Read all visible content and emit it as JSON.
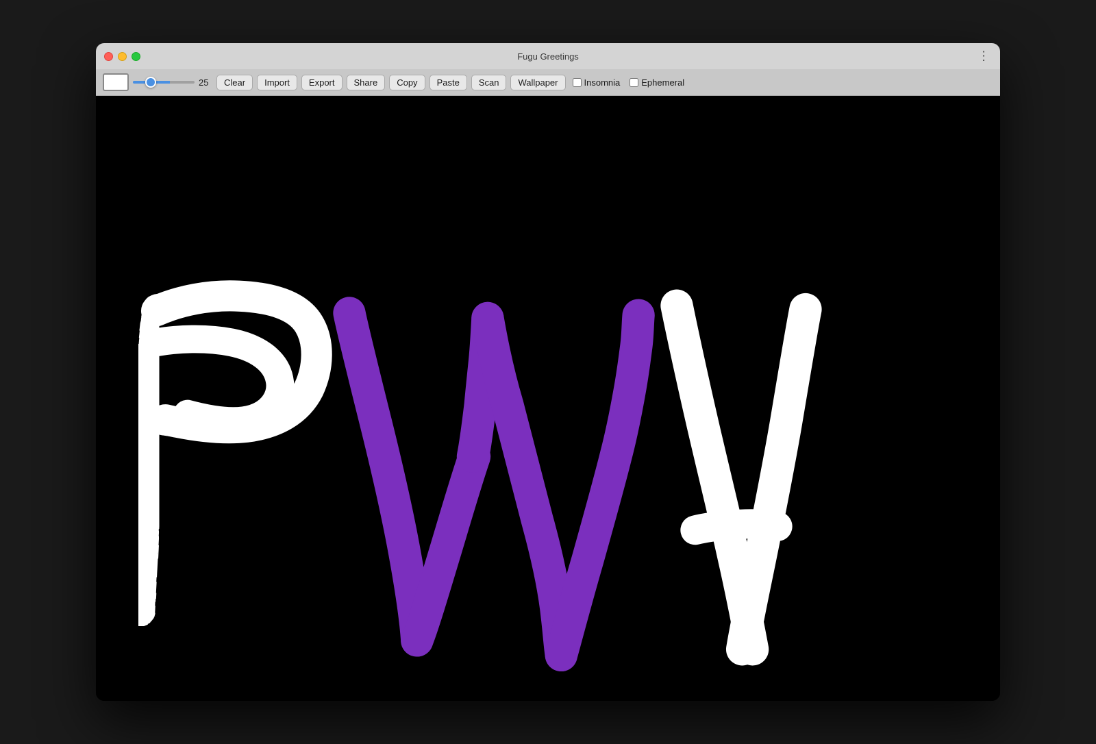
{
  "window": {
    "title": "Fugu Greetings",
    "traffic_lights": {
      "red": "close",
      "yellow": "minimize",
      "green": "fullscreen"
    },
    "menu_dots": "⋮"
  },
  "toolbar": {
    "color_swatch_color": "#ffffff",
    "brush_size": 25,
    "brush_min": 1,
    "brush_max": 100,
    "buttons": [
      {
        "id": "clear",
        "label": "Clear"
      },
      {
        "id": "import",
        "label": "Import"
      },
      {
        "id": "export",
        "label": "Export"
      },
      {
        "id": "share",
        "label": "Share"
      },
      {
        "id": "copy",
        "label": "Copy"
      },
      {
        "id": "paste",
        "label": "Paste"
      },
      {
        "id": "scan",
        "label": "Scan"
      },
      {
        "id": "wallpaper",
        "label": "Wallpaper"
      }
    ],
    "checkboxes": [
      {
        "id": "insomnia",
        "label": "Insomnia",
        "checked": false
      },
      {
        "id": "ephemeral",
        "label": "Ephemeral",
        "checked": false
      }
    ]
  },
  "canvas": {
    "background": "#000000",
    "drawing_title": "PWA drawing on black background"
  }
}
